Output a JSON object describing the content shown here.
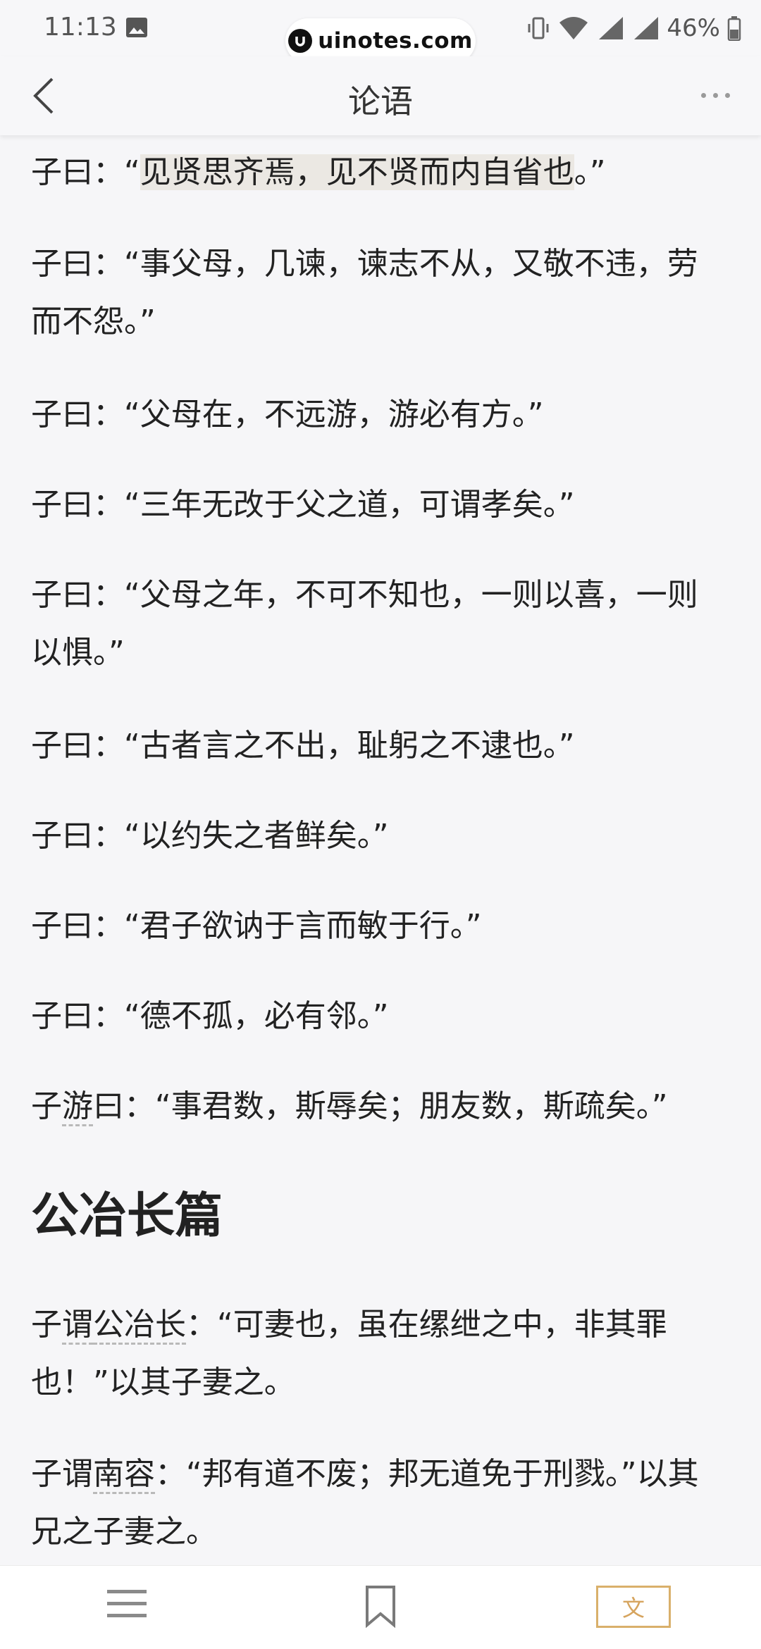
{
  "status_bar": {
    "time": "11:13",
    "battery": "46%",
    "site": "uinotes.com",
    "icons": [
      "gallery-icon",
      "vibrate-icon",
      "wifi-icon",
      "signal-icon",
      "battery-icon"
    ]
  },
  "header": {
    "title": "论语",
    "back_icon": "chevron-left-icon",
    "more_icon": "more-dots-icon"
  },
  "content": {
    "p1": {
      "prefix": "子曰：“",
      "highlight": "见贤思齐焉，见不贤而内自省也",
      "suffix": "。”"
    },
    "p2": "子曰：“事父母，几谏，谏志不从，又敬不违，劳而不怨。”",
    "p3": "子曰：“父母在，不远游，游必有方。”",
    "p4": "子曰：“三年无改于父之道，可谓孝矣。”",
    "p5": "子曰：“父母之年，不可不知也，一则以喜，一则以惧。”",
    "p6": "子曰：“古者言之不出，耻躬之不逮也。”",
    "p7": "子曰：“以约失之者鲜矣。”",
    "p8": "子曰：“君子欲讷于言而敏于行。”",
    "p9": "子曰：“德不孤，必有邻。”",
    "p10": {
      "pre": "子",
      "link": "游",
      "rest": "曰：“事君数，斯辱矣；朋友数，斯疏矣。”"
    },
    "section_heading": "公冶长篇",
    "p11": {
      "pre": "子",
      "link1": "谓",
      "link2": "公冶长",
      "rest": "：“可妻也，虽在缧绁之中，非其罪也！”以其子妻之。"
    },
    "p12": {
      "pre": "子谓",
      "link": "南容",
      "rest": "：“邦有道不废；邦无道免于刑戮。”以其兄之子妻之。"
    }
  },
  "bottom_bar": {
    "menu_icon": "menu-icon",
    "bookmark_icon": "bookmark-icon",
    "lang_label": "文"
  },
  "colors": {
    "background": "#f6f6f8",
    "highlight": "#ebe8e3",
    "accent": "#d6a45e"
  }
}
